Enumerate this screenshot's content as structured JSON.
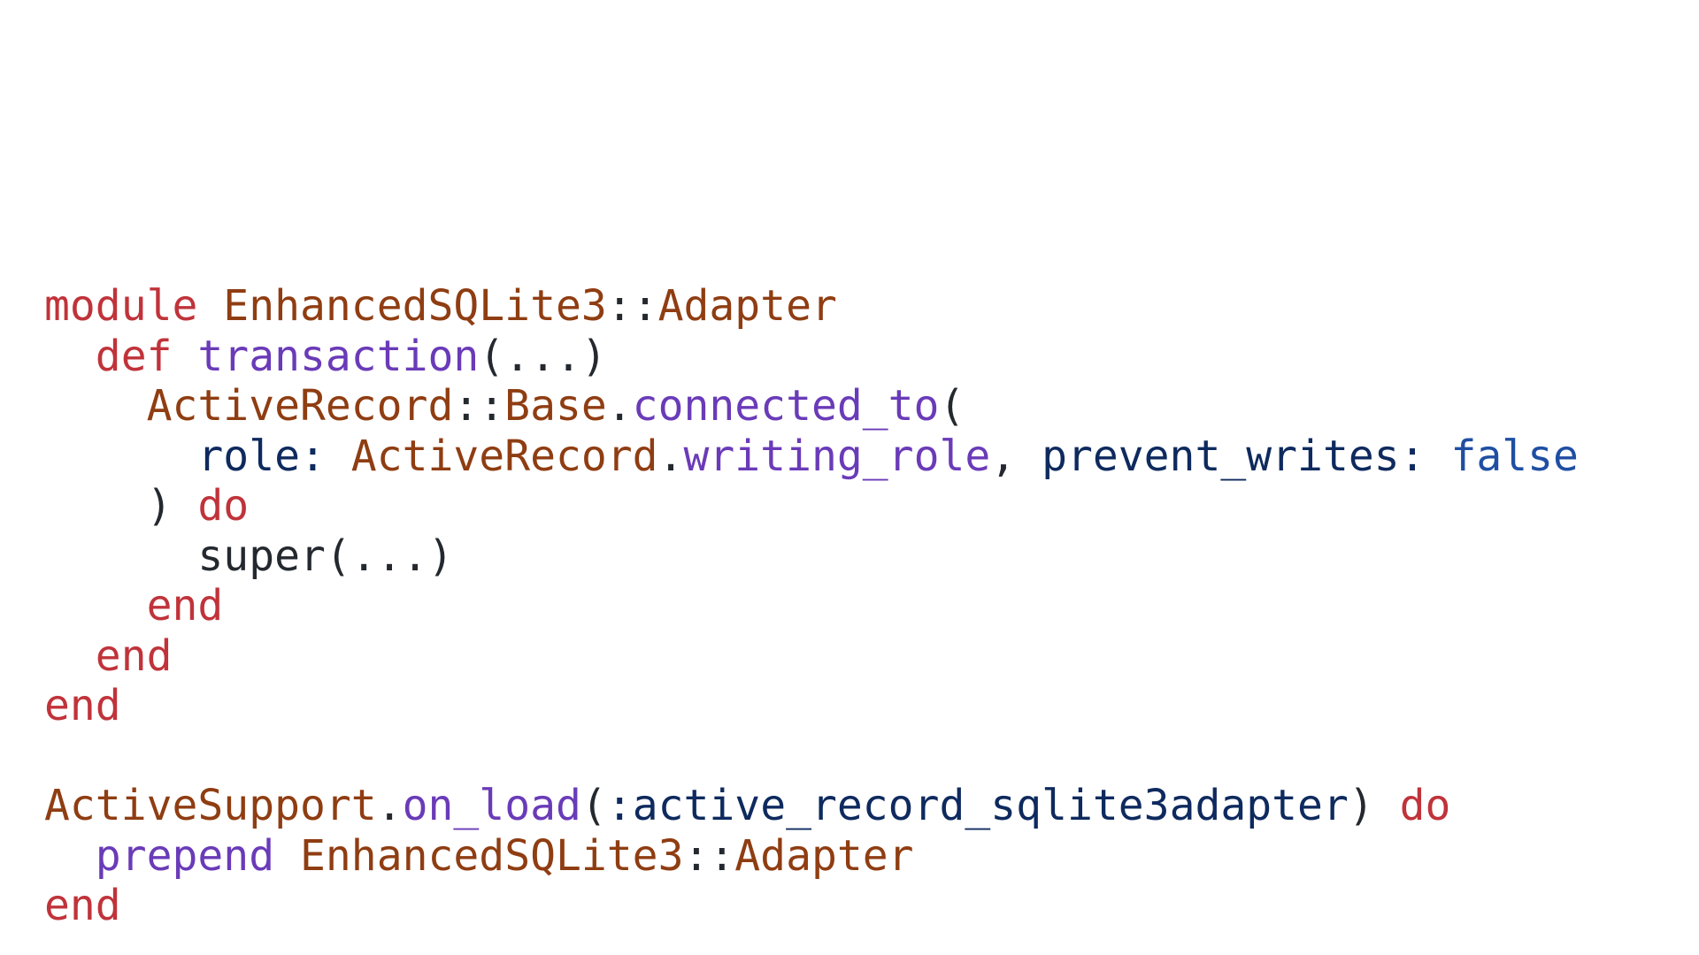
{
  "colors": {
    "keyword": "#c0333a",
    "constant": "#8f3d12",
    "method": "#6a3bb8",
    "symbol": "#0e2a5e",
    "literal": "#1f4fa3",
    "plain": "#24292f",
    "background": "#ffffff"
  },
  "code": {
    "language": "ruby",
    "lines": [
      [
        {
          "t": "module",
          "c": "kw"
        },
        {
          "t": " ",
          "c": "pl"
        },
        {
          "t": "EnhancedSQLite3",
          "c": "cls"
        },
        {
          "t": "::",
          "c": "pl"
        },
        {
          "t": "Adapter",
          "c": "cls"
        }
      ],
      [
        {
          "t": "  ",
          "c": "pl"
        },
        {
          "t": "def",
          "c": "kw"
        },
        {
          "t": " ",
          "c": "pl"
        },
        {
          "t": "transaction",
          "c": "fn"
        },
        {
          "t": "(...)",
          "c": "pl"
        }
      ],
      [
        {
          "t": "    ",
          "c": "pl"
        },
        {
          "t": "ActiveRecord",
          "c": "cls"
        },
        {
          "t": "::",
          "c": "pl"
        },
        {
          "t": "Base",
          "c": "cls"
        },
        {
          "t": ".",
          "c": "pl"
        },
        {
          "t": "connected_to",
          "c": "fn"
        },
        {
          "t": "(",
          "c": "pl"
        }
      ],
      [
        {
          "t": "      ",
          "c": "pl"
        },
        {
          "t": "role:",
          "c": "sym"
        },
        {
          "t": " ",
          "c": "pl"
        },
        {
          "t": "ActiveRecord",
          "c": "cls"
        },
        {
          "t": ".",
          "c": "pl"
        },
        {
          "t": "writing_role",
          "c": "fn"
        },
        {
          "t": ", ",
          "c": "pl"
        },
        {
          "t": "prevent_writes:",
          "c": "sym"
        },
        {
          "t": " ",
          "c": "pl"
        },
        {
          "t": "false",
          "c": "lit"
        }
      ],
      [
        {
          "t": "    ) ",
          "c": "pl"
        },
        {
          "t": "do",
          "c": "kw"
        }
      ],
      [
        {
          "t": "      super(...)",
          "c": "pl"
        }
      ],
      [
        {
          "t": "    ",
          "c": "pl"
        },
        {
          "t": "end",
          "c": "kw"
        }
      ],
      [
        {
          "t": "  ",
          "c": "pl"
        },
        {
          "t": "end",
          "c": "kw"
        }
      ],
      [
        {
          "t": "end",
          "c": "kw"
        }
      ],
      [],
      [
        {
          "t": "ActiveSupport",
          "c": "cls"
        },
        {
          "t": ".",
          "c": "pl"
        },
        {
          "t": "on_load",
          "c": "fn"
        },
        {
          "t": "(",
          "c": "pl"
        },
        {
          "t": ":active_record_sqlite3adapter",
          "c": "sym"
        },
        {
          "t": ") ",
          "c": "pl"
        },
        {
          "t": "do",
          "c": "kw"
        }
      ],
      [
        {
          "t": "  ",
          "c": "pl"
        },
        {
          "t": "prepend",
          "c": "fn"
        },
        {
          "t": " ",
          "c": "pl"
        },
        {
          "t": "EnhancedSQLite3",
          "c": "cls"
        },
        {
          "t": "::",
          "c": "pl"
        },
        {
          "t": "Adapter",
          "c": "cls"
        }
      ],
      [
        {
          "t": "end",
          "c": "kw"
        }
      ]
    ]
  }
}
